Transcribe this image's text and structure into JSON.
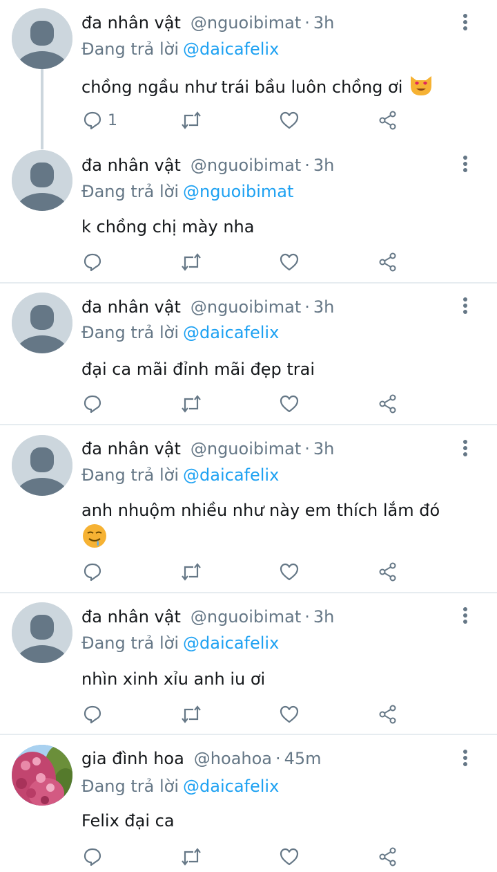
{
  "reply_prefix": "Đang trả lời",
  "dot": "·",
  "colors": {
    "link": "#1da1f2",
    "muted": "#657786",
    "avatar_bg": "#ccd6dd",
    "divider": "#e6ecf0"
  },
  "icons": [
    "avatar-placeholder-icon",
    "more-vertical-icon",
    "reply-icon",
    "retweet-icon",
    "like-icon",
    "share-icon",
    "heart-eyes-cat-emoji",
    "drooling-face-emoji"
  ],
  "tweets": [
    {
      "name": "đa nhân vật",
      "handle": "@nguoibimat",
      "time": "3h",
      "reply_to": "@daicafelix",
      "text": "chồng ngầu như trái bầu luôn chồng ơi",
      "emoji": "heart-eyes-cat-emoji",
      "reply_count": "1"
    },
    {
      "name": "đa nhân vật",
      "handle": "@nguoibimat",
      "time": "3h",
      "reply_to": "@nguoibimat",
      "text": "k chồng chị mày nha",
      "reply_count": ""
    },
    {
      "name": "đa nhân vật",
      "handle": "@nguoibimat",
      "time": "3h",
      "reply_to": "@daicafelix",
      "text": "đại ca mãi đỉnh mãi đẹp trai",
      "reply_count": ""
    },
    {
      "name": "đa nhân vật",
      "handle": "@nguoibimat",
      "time": "3h",
      "reply_to": "@daicafelix",
      "text": "anh nhuộm nhiều như này em thích lắm đó",
      "emoji": "drooling-face-emoji",
      "reply_count": ""
    },
    {
      "name": "đa nhân vật",
      "handle": "@nguoibimat",
      "time": "3h",
      "reply_to": "@daicafelix",
      "text": "nhìn xinh xỉu anh iu ơi",
      "reply_count": ""
    },
    {
      "name": "gia đình hoa",
      "handle": "@hoahoa",
      "time": "45m",
      "reply_to": "@daicafelix",
      "text": "Felix đại ca",
      "reply_count": ""
    }
  ]
}
